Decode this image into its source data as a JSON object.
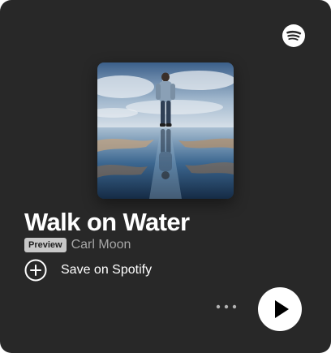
{
  "logo": {
    "icon": "spotify-icon"
  },
  "track": {
    "title": "Walk on Water",
    "badge": "Preview",
    "artist": "Carl Moon",
    "cover_art": "album-cover-image"
  },
  "actions": {
    "save_label": "Save on Spotify",
    "save_icon": "plus-circle-icon",
    "more_icon": "more-options-icon",
    "play_icon": "play-icon"
  },
  "colors": {
    "card_background": "#282828",
    "text_primary": "#ffffff",
    "text_secondary": "#a7a7a7",
    "badge_background": "#c8c8c8",
    "play_button_background": "#ffffff"
  }
}
